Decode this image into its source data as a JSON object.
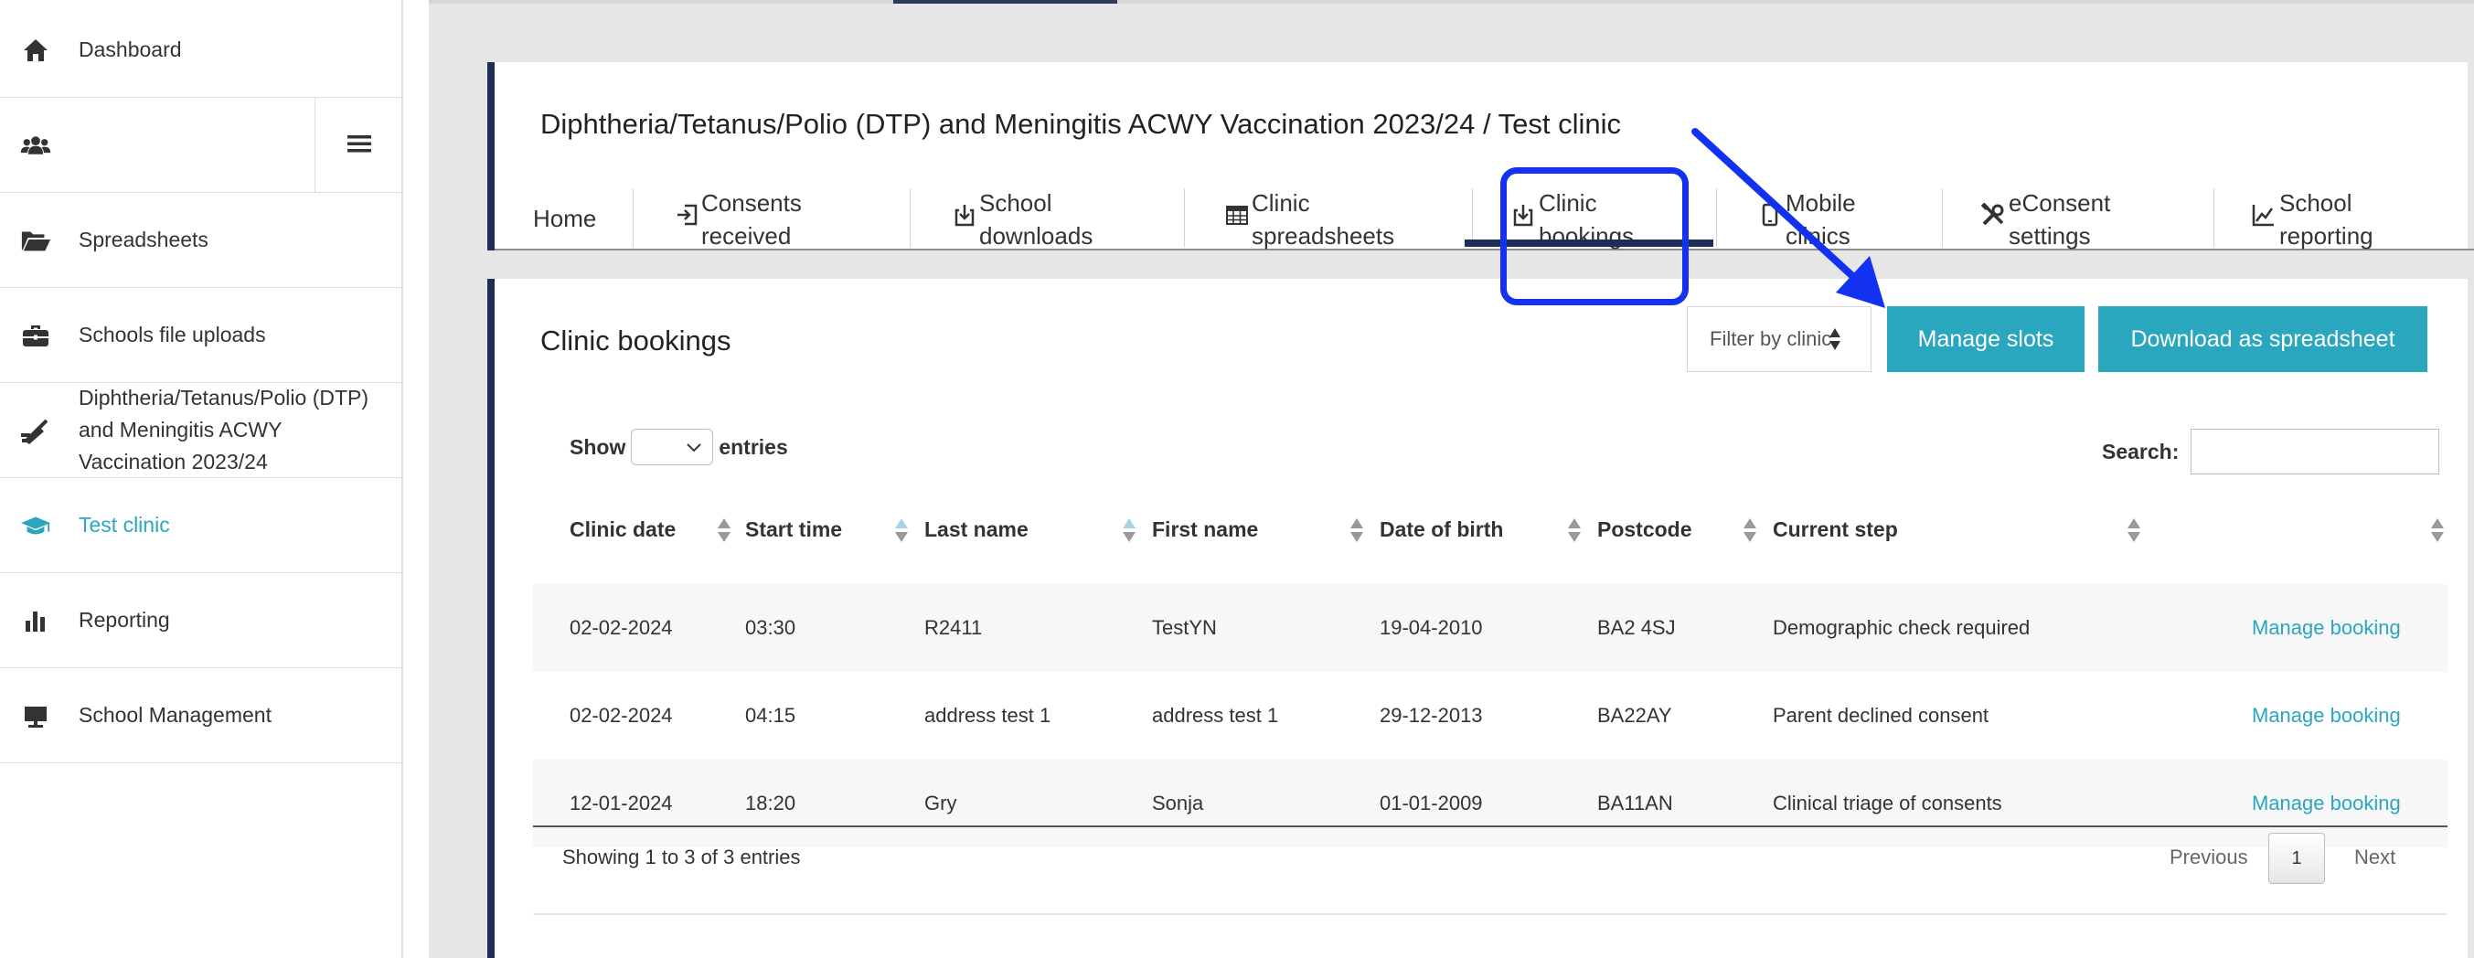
{
  "colors": {
    "accent": "#2ba6bf",
    "navy": "#1f2e57",
    "annotation_blue": "#1231f0"
  },
  "sidebar": {
    "items": [
      {
        "label": "Dashboard",
        "icon": "home-icon"
      },
      {
        "label": "",
        "icon": "users-icon"
      },
      {
        "label": "Spreadsheets",
        "icon": "folder-open-icon"
      },
      {
        "label": "Schools file uploads",
        "icon": "briefcase-icon"
      },
      {
        "label": "Diphtheria/Tetanus/Polio (DTP) and Meningitis ACWY Vaccination 2023/24",
        "icon": "syringe-icon"
      },
      {
        "label": "Test clinic",
        "icon": "graduation-cap-icon",
        "active": true
      },
      {
        "label": "Reporting",
        "icon": "bar-chart-icon"
      },
      {
        "label": "School Management",
        "icon": "easel-icon"
      }
    ],
    "menu_toggle_icon": "hamburger-icon"
  },
  "header": {
    "title": "Diphtheria/Tetanus/Polio (DTP) and Meningitis ACWY Vaccination 2023/24 / Test clinic",
    "tabs": [
      {
        "label": "Home",
        "icon": ""
      },
      {
        "label": "Consents received",
        "icon": "sign-in-icon"
      },
      {
        "label": "School downloads",
        "icon": "download-icon"
      },
      {
        "label": "Clinic spreadsheets",
        "icon": "table-icon"
      },
      {
        "label": "Clinic bookings",
        "icon": "download-icon",
        "active": true
      },
      {
        "label": "Mobile clinics",
        "icon": "mobile-icon"
      },
      {
        "label": "eConsent settings",
        "icon": "tools-icon"
      },
      {
        "label": "School reporting",
        "icon": "line-chart-icon"
      }
    ]
  },
  "bookings": {
    "title": "Clinic bookings",
    "filter_placeholder": "Filter by clinic",
    "manage_slots_label": "Manage slots",
    "download_label": "Download as spreadsheet",
    "show_label": "Show",
    "entries_label": "entries",
    "search_label": "Search:",
    "columns": [
      "Clinic date",
      "Start time",
      "Last name",
      "First name",
      "Date of birth",
      "Postcode",
      "Current step",
      ""
    ],
    "rows": [
      {
        "clinic_date": "02-02-2024",
        "start_time": "03:30",
        "last_name": "R2411",
        "first_name": "TestYN",
        "dob": "19-04-2010",
        "postcode": "BA2 4SJ",
        "step": "Demographic check required",
        "action": "Manage booking"
      },
      {
        "clinic_date": "02-02-2024",
        "start_time": "04:15",
        "last_name": "address test 1",
        "first_name": "address test 1",
        "dob": "29-12-2013",
        "postcode": "BA22AY",
        "step": "Parent declined consent",
        "action": "Manage booking"
      },
      {
        "clinic_date": "12-01-2024",
        "start_time": "18:20",
        "last_name": "Gry",
        "first_name": "Sonja",
        "dob": "01-01-2009",
        "postcode": "BA11AN",
        "step": "Clinical triage of consents",
        "action": "Manage booking"
      }
    ],
    "showing_info": "Showing 1 to 3 of 3 entries",
    "previous_label": "Previous",
    "current_page": "1",
    "next_label": "Next"
  }
}
